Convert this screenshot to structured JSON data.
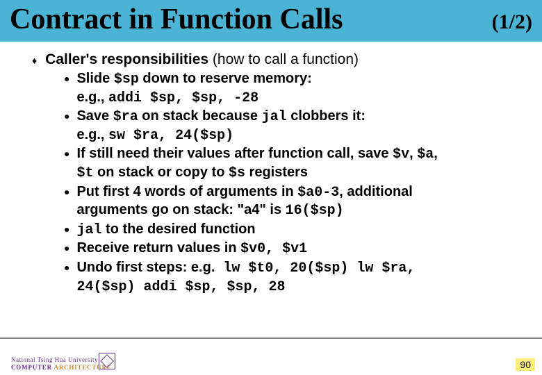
{
  "title": {
    "main": "Contract in Function Calls",
    "page": "(1/2)"
  },
  "heading": {
    "bold": "Caller's responsibilities",
    "rest": " (how to call a function)"
  },
  "bullets": [
    {
      "line1_pre": "Slide ",
      "line1_code": "$sp",
      "line1_post": " down to reserve memory:",
      "line2_pre": "e.g., ",
      "line2_code": "addi $sp, $sp, -28"
    },
    {
      "line1_pre": "Save ",
      "line1_code": "$ra",
      "line1_mid": " on stack because ",
      "line1_code2": "jal",
      "line1_post": " clobbers it:",
      "line2_pre": "e.g., ",
      "line2_code": "sw $ra, 24($sp)"
    },
    {
      "line1_pre": "If still need their values after function call, save ",
      "line1_code": "$v",
      "line1_mid": ", ",
      "line1_code2": "$a",
      "line1_post": ",",
      "line2_code": "$t",
      "line2_mid": " on stack or copy to ",
      "line2_code2": "$s",
      "line2_post": " registers"
    },
    {
      "line1_pre": "Put first 4 words of arguments in ",
      "line1_code": "$a0-3",
      "line1_post": ", additional",
      "line2_pre": "arguments go on stack: \"a4\" is ",
      "line2_code": "16($sp)"
    },
    {
      "line1_code": "jal",
      "line1_post": " to the desired function"
    },
    {
      "line1_pre": "Receive return values in ",
      "line1_code": "$v0, $v1"
    },
    {
      "line1_pre": "Undo first steps: e.g.",
      "line1_code": " lw $t0, 20($sp) lw $ra,",
      "line2_code": "24($sp) addi $sp, $sp, 28"
    }
  ],
  "footer": {
    "uni": "National Tsing Hua University",
    "dept_a": "COMPUTER",
    "dept_b": "ARCHITECTURE",
    "page_num": "90"
  }
}
